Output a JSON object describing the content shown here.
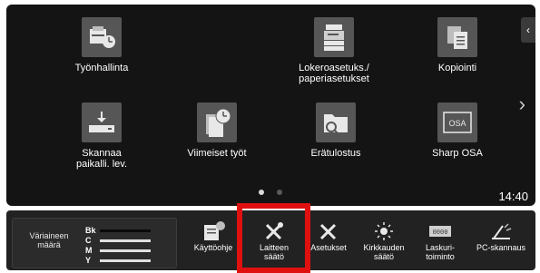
{
  "apps": [
    {
      "id": "tyonhallinta",
      "icon": "job-status-icon",
      "lines": [
        "Työnhallinta"
      ]
    },
    {
      "id": "lokero",
      "icon": "tray-settings-icon",
      "lines": [
        "Lokeroasetuks./",
        "paperiasetukset"
      ]
    },
    {
      "id": "kopiointi",
      "icon": "copy-icon",
      "lines": [
        "Kopiointi"
      ]
    },
    {
      "id": "skannaa",
      "icon": "scan-to-hdd-icon",
      "lines": [
        "Skannaa",
        "paikalli. lev."
      ]
    },
    {
      "id": "viimeiset",
      "icon": "recent-jobs-icon",
      "lines": [
        "Viimeiset työt"
      ]
    },
    {
      "id": "eratulostus",
      "icon": "folder-search-icon",
      "lines": [
        "Erätulostus"
      ]
    },
    {
      "id": "sharp",
      "icon": "sharp-osa-icon",
      "lines": [
        "Sharp OSA"
      ],
      "badge": "OSA"
    }
  ],
  "handle_glyph": "‹",
  "next_glyph": "›",
  "clock": "14:40",
  "toner": {
    "title": [
      "Väriaineen",
      "määrä"
    ],
    "rows": [
      {
        "c": "Bk",
        "light": false
      },
      {
        "c": "C",
        "light": true
      },
      {
        "c": "M",
        "light": true
      },
      {
        "c": "Y",
        "light": true
      }
    ]
  },
  "taskbar": [
    {
      "id": "kayttoohje",
      "icon": "manual-icon",
      "lines": [
        "Käyttöohje"
      ]
    },
    {
      "id": "laitteen",
      "icon": "device-adjust-icon",
      "lines": [
        "Laitteen",
        "säätö"
      ]
    },
    {
      "id": "asetukset",
      "icon": "settings-tools-icon",
      "lines": [
        "Asetukset"
      ]
    },
    {
      "id": "kirkkaus",
      "icon": "brightness-icon",
      "lines": [
        "Kirkkauden",
        "säätö"
      ]
    },
    {
      "id": "laskuri",
      "icon": "counter-icon",
      "lines": [
        "Laskuri-",
        "toiminto"
      ],
      "badge": "0000"
    },
    {
      "id": "pcskannaus",
      "icon": "pc-scan-icon",
      "lines": [
        "PC-skannaus"
      ]
    }
  ]
}
